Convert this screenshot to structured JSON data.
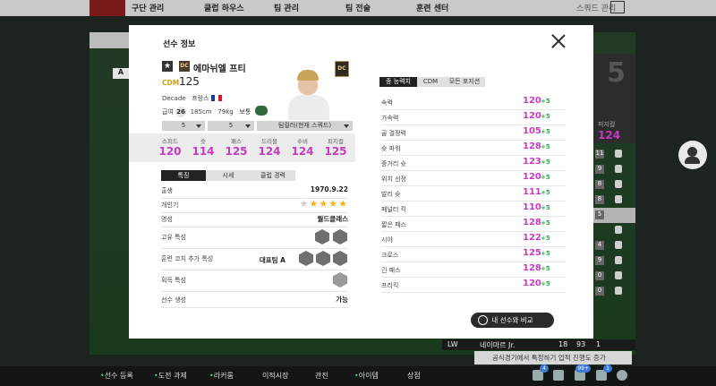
{
  "top_nav": {
    "items": [
      "구단 관리",
      "클럽 하우스",
      "팀 관리",
      "팀 전술",
      "훈련 센터",
      "스쿼드 관리"
    ]
  },
  "background": {
    "left_chip": "A",
    "bench_player": {
      "position": "LW",
      "name": "네이마르 Jr.",
      "level": "18",
      "ovr": "93",
      "count": "1"
    },
    "right_card": {
      "label": "피지컬",
      "value": "124"
    },
    "right_list_numbers": [
      "11",
      "9",
      "8",
      "8",
      "5",
      "",
      "4",
      "9",
      "0",
      "0"
    ],
    "toast": "공식경기에서 특정하기 업적 진행도 증가"
  },
  "bottom_bar": {
    "items": [
      "선수 등록",
      "도전 과제",
      "라커룸",
      "이적시장",
      "관전",
      "아이템",
      "상점"
    ],
    "badges": [
      "4",
      "99+",
      "1"
    ]
  },
  "modal": {
    "title": "선수 정보",
    "player": {
      "season_badge": "DC",
      "name": "에마뉘엘 프티",
      "position": "CDM",
      "ovr": "125",
      "season": "Decade",
      "nationality": "프랑스",
      "salary_label": "급여",
      "salary": "26",
      "height": "185cm",
      "weight": "79kg",
      "body_type": "보통",
      "foot_left": "5",
      "foot_right": "3"
    },
    "selects": {
      "level": "5",
      "grade": "5",
      "team_color": "팀컬러(현재 스쿼드)"
    },
    "main_stats": [
      {
        "label": "스피드",
        "value": "120"
      },
      {
        "label": "슛",
        "value": "114"
      },
      {
        "label": "패스",
        "value": "125"
      },
      {
        "label": "드리블",
        "value": "124"
      },
      {
        "label": "수비",
        "value": "124"
      },
      {
        "label": "피지컬",
        "value": "125"
      }
    ],
    "sub_tabs": [
      "특징",
      "시세",
      "클럽 경력"
    ],
    "info_rows": {
      "birth_label": "출생",
      "birth": "1970.9.22",
      "popularity_label": "개인기",
      "popularity_stars": 4,
      "reputation_label": "명성",
      "reputation": "월드클래스",
      "unique_trait_label": "고유 특성",
      "coach_trait_label": "훈련 코치 추가 특성",
      "coach_trait_value": "대표팀 A",
      "acquired_trait_label": "획득 특성",
      "create_label": "선수 생성",
      "create_value": "가능"
    },
    "right_tabs": [
      "종 능력치",
      "CDM",
      "모든 포지션"
    ],
    "attributes": [
      {
        "label": "속력",
        "value": "120",
        "delta": "+5"
      },
      {
        "label": "가속력",
        "value": "120",
        "delta": "+5"
      },
      {
        "label": "골 결정력",
        "value": "105",
        "delta": "+5"
      },
      {
        "label": "슛 파워",
        "value": "128",
        "delta": "+5"
      },
      {
        "label": "중거리 슛",
        "value": "123",
        "delta": "+5"
      },
      {
        "label": "위치 선정",
        "value": "120",
        "delta": "+5"
      },
      {
        "label": "발리 슛",
        "value": "111",
        "delta": "+5"
      },
      {
        "label": "페널티 킥",
        "value": "110",
        "delta": "+5"
      },
      {
        "label": "짧은 패스",
        "value": "128",
        "delta": "+5"
      },
      {
        "label": "시야",
        "value": "122",
        "delta": "+5"
      },
      {
        "label": "크로스",
        "value": "125",
        "delta": "+5"
      },
      {
        "label": "긴 패스",
        "value": "128",
        "delta": "+5"
      },
      {
        "label": "프리킥",
        "value": "120",
        "delta": "+5"
      }
    ],
    "compare_button": "내 선수와 비교"
  }
}
